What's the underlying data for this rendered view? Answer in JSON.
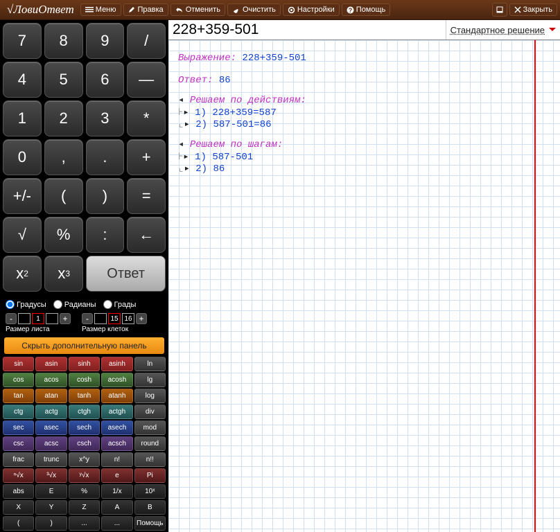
{
  "app_name": "ЛовиОтвет",
  "toolbar": {
    "menu": "Меню",
    "edit": "Правка",
    "undo": "Отменить",
    "clear": "Очистить",
    "settings": "Настройки",
    "help": "Помощь",
    "close": "Закрыть"
  },
  "expression": "228+359-501",
  "solution_type": "Стандартное решение",
  "keypad": {
    "k7": "7",
    "k8": "8",
    "k9": "9",
    "kdiv": "/",
    "k4": "4",
    "k5": "5",
    "k6": "6",
    "kminus": "—",
    "k1": "1",
    "k2": "2",
    "k3": "3",
    "kmul": "*",
    "k0": "0",
    "kcomma": ",",
    "kdot": ".",
    "kplus": "+",
    "kpm": "+/-",
    "klp": "(",
    "krp": ")",
    "keq": "=",
    "ksqrt": "√",
    "kpct": "%",
    "kccc": ":",
    "kback": "←",
    "kx2": "x",
    "kx2s": "2",
    "kx3": "x",
    "kx3s": "3",
    "kanswer": "Ответ"
  },
  "angles": {
    "deg": "Градусы",
    "rad": "Радианы",
    "grad": "Грады",
    "selected": "deg"
  },
  "sizes": {
    "sheet_label": "Размер листа",
    "sheet_val": "1",
    "cell_label": "Размер клеток",
    "cell_val": "15",
    "cell_next": "16"
  },
  "toggle_panel": "Скрыть дополнительную панель",
  "extra": [
    [
      {
        "t": "sin",
        "c": "c-red"
      },
      {
        "t": "asin",
        "c": "c-red"
      },
      {
        "t": "sinh",
        "c": "c-red"
      },
      {
        "t": "asinh",
        "c": "c-red"
      },
      {
        "t": "ln",
        "c": "c-gray"
      }
    ],
    [
      {
        "t": "cos",
        "c": "c-green"
      },
      {
        "t": "acos",
        "c": "c-green"
      },
      {
        "t": "cosh",
        "c": "c-green"
      },
      {
        "t": "acosh",
        "c": "c-green"
      },
      {
        "t": "lg",
        "c": "c-gray"
      }
    ],
    [
      {
        "t": "tan",
        "c": "c-orange"
      },
      {
        "t": "atan",
        "c": "c-orange"
      },
      {
        "t": "tanh",
        "c": "c-orange"
      },
      {
        "t": "atanh",
        "c": "c-orange"
      },
      {
        "t": "log",
        "c": "c-gray"
      }
    ],
    [
      {
        "t": "ctg",
        "c": "c-teal"
      },
      {
        "t": "actg",
        "c": "c-teal"
      },
      {
        "t": "ctgh",
        "c": "c-teal"
      },
      {
        "t": "actgh",
        "c": "c-teal"
      },
      {
        "t": "div",
        "c": "c-gray"
      }
    ],
    [
      {
        "t": "sec",
        "c": "c-blue"
      },
      {
        "t": "asec",
        "c": "c-blue"
      },
      {
        "t": "sech",
        "c": "c-blue"
      },
      {
        "t": "asech",
        "c": "c-blue"
      },
      {
        "t": "mod",
        "c": "c-gray"
      }
    ],
    [
      {
        "t": "csc",
        "c": "c-purple"
      },
      {
        "t": "acsc",
        "c": "c-purple"
      },
      {
        "t": "csch",
        "c": "c-purple"
      },
      {
        "t": "acsch",
        "c": "c-purple"
      },
      {
        "t": "round",
        "c": "c-gray"
      }
    ],
    [
      {
        "t": "frac",
        "c": "c-gray"
      },
      {
        "t": "trunc",
        "c": "c-gray"
      },
      {
        "t": "x^y",
        "c": "c-gray"
      },
      {
        "t": "n!",
        "c": "c-gray"
      },
      {
        "t": "n!!",
        "c": "c-gray"
      }
    ],
    [
      {
        "t": "ⁿ√x",
        "c": "c-dred"
      },
      {
        "t": "³√x",
        "c": "c-dred"
      },
      {
        "t": "ʸ√x",
        "c": "c-dred"
      },
      {
        "t": "e",
        "c": "c-dred"
      },
      {
        "t": "Pi",
        "c": "c-dred"
      }
    ],
    [
      {
        "t": "abs",
        "c": "c-dark"
      },
      {
        "t": "E",
        "c": "c-dark"
      },
      {
        "t": "%",
        "c": "c-dark"
      },
      {
        "t": "1/x",
        "c": "c-dark"
      },
      {
        "t": "10ˣ",
        "c": "c-dark"
      }
    ],
    [
      {
        "t": "X",
        "c": "c-dark"
      },
      {
        "t": "Y",
        "c": "c-dark"
      },
      {
        "t": "Z",
        "c": "c-dark"
      },
      {
        "t": "A",
        "c": "c-dark"
      },
      {
        "t": "B",
        "c": "c-dark"
      }
    ],
    [
      {
        "t": "(",
        "c": "c-dark"
      },
      {
        "t": ")",
        "c": "c-dark"
      },
      {
        "t": "...",
        "c": "c-dark"
      },
      {
        "t": "...",
        "c": "c-dark"
      },
      {
        "t": "Помощь",
        "c": "c-dark"
      }
    ]
  ],
  "solution": {
    "expr_label": "Выражение:",
    "expr_val": "228+359-501",
    "ans_label": "Ответ:",
    "ans_val": "86",
    "by_actions": "Решаем по действиям:",
    "act1": "1) 228+359=587",
    "act2": "2) 587-501=86",
    "by_steps": "Решаем по шагам:",
    "step1": "1) 587-501",
    "step2": "2) 86"
  }
}
